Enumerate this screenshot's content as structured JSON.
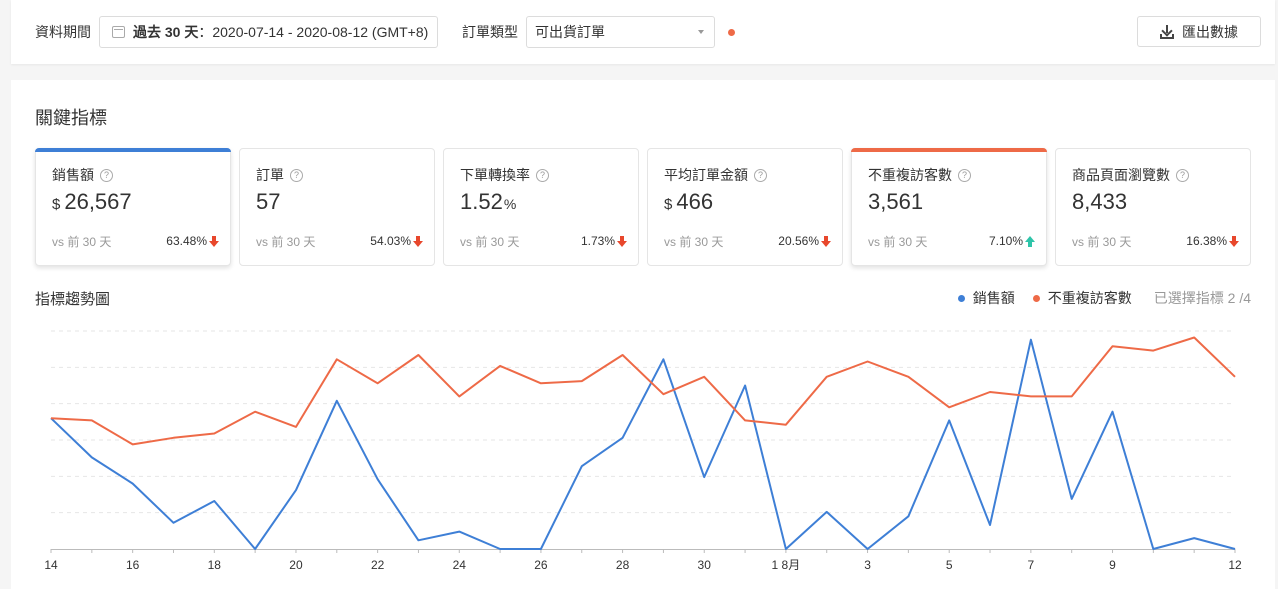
{
  "filters": {
    "period_label": "資料期間",
    "period_prefix": "過去 30 天",
    "period_range": "：2020-07-14 - 2020-08-12 (GMT+8)",
    "order_type_label": "訂單類型",
    "order_type_value": "可出貨訂單",
    "export_label": "匯出數據"
  },
  "metrics": {
    "title": "關鍵指標",
    "vs_label": "vs 前 30 天",
    "cards": [
      {
        "title": "銷售額",
        "currency": "$",
        "value": "26,567",
        "unit": "",
        "change": "63.48%",
        "direction": "down",
        "selected": true,
        "accent": "#3e7fd6"
      },
      {
        "title": "訂單",
        "currency": "",
        "value": "57",
        "unit": "",
        "change": "54.03%",
        "direction": "down",
        "selected": false,
        "accent": ""
      },
      {
        "title": "下單轉換率",
        "currency": "",
        "value": "1.52",
        "unit": "%",
        "change": "1.73%",
        "direction": "down",
        "selected": false,
        "accent": ""
      },
      {
        "title": "平均訂單金額",
        "currency": "$",
        "value": "466",
        "unit": "",
        "change": "20.56%",
        "direction": "down",
        "selected": false,
        "accent": ""
      },
      {
        "title": "不重複訪客數",
        "currency": "",
        "value": "3,561",
        "unit": "",
        "change": "7.10%",
        "direction": "up",
        "selected": true,
        "accent": "#ee6a47"
      },
      {
        "title": "商品頁面瀏覽數",
        "currency": "",
        "value": "8,433",
        "unit": "",
        "change": "16.38%",
        "direction": "down",
        "selected": false,
        "accent": ""
      }
    ],
    "colors": {
      "down": "#e8472c",
      "up": "#2ec4a9"
    }
  },
  "trend": {
    "title": "指標趨勢圖",
    "selected_count": "已選擇指標 2 /4"
  },
  "chart_data": {
    "type": "line",
    "x": [
      "14",
      "15",
      "16",
      "17",
      "18",
      "19",
      "20",
      "21",
      "22",
      "23",
      "24",
      "25",
      "26",
      "27",
      "28",
      "29",
      "30",
      "31",
      "1 8月",
      "2",
      "3",
      "4",
      "5",
      "6",
      "7",
      "8",
      "9",
      "10",
      "11",
      "12"
    ],
    "tick_labels": [
      "14",
      "16",
      "18",
      "20",
      "22",
      "24",
      "26",
      "28",
      "30",
      "1 8月",
      "3",
      "5",
      "7",
      "9",
      "12"
    ],
    "ylim": [
      0,
      100
    ],
    "grid": true,
    "legend": "top-right",
    "series": [
      {
        "name": "銷售額",
        "color": "#3e7fd6",
        "values": [
          60,
          42,
          30,
          12,
          22,
          0,
          27,
          68,
          32,
          4,
          8,
          0,
          0,
          38,
          51,
          87,
          33,
          75,
          0,
          17,
          0,
          15,
          59,
          11,
          96,
          23,
          63,
          0,
          5,
          0
        ]
      },
      {
        "name": "不重複訪客數",
        "color": "#ee6a47",
        "values": [
          60,
          59,
          48,
          51,
          53,
          63,
          56,
          87,
          76,
          89,
          70,
          84,
          76,
          77,
          89,
          71,
          79,
          59,
          57,
          79,
          86,
          79,
          65,
          72,
          70,
          70,
          93,
          91,
          97,
          79
        ]
      }
    ]
  }
}
